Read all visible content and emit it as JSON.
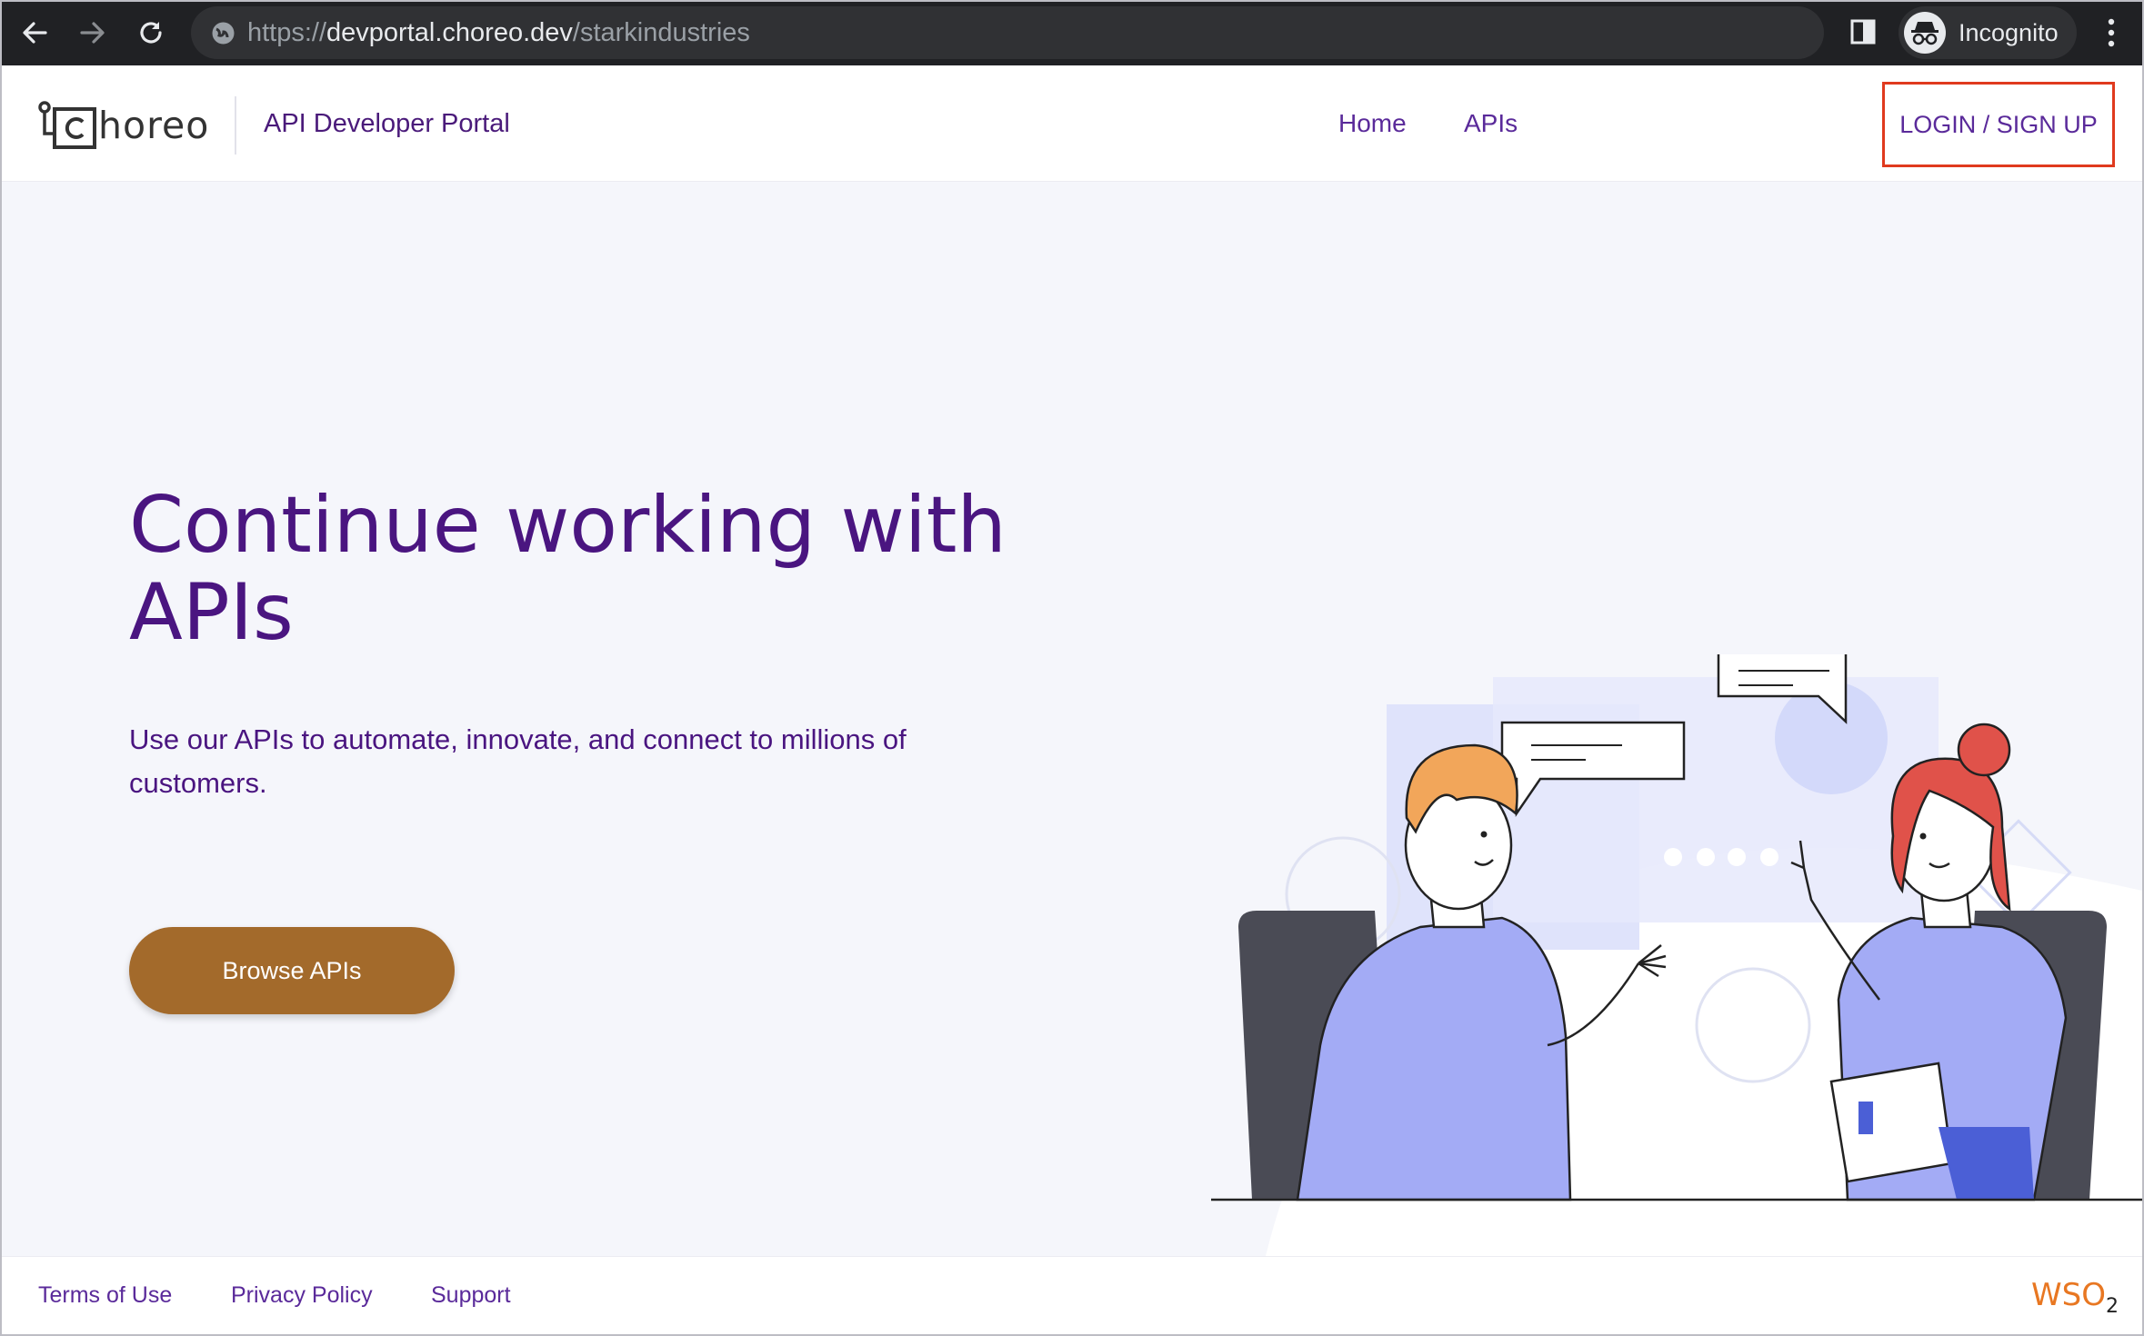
{
  "browser": {
    "url_prefix": "https://",
    "url_host": "devportal.choreo.dev",
    "url_path": "/starkindustries",
    "incognito_label": "Incognito",
    "icons": [
      "back-arrow-icon",
      "forward-arrow-icon",
      "reload-icon",
      "site-info-icon",
      "side-panel-icon",
      "incognito-icon",
      "more-menu-icon"
    ]
  },
  "header": {
    "logo_text": "horeo",
    "portal_title": "API Developer Portal",
    "nav": [
      "Home",
      "APIs"
    ],
    "login_label": "LOGIN / SIGN UP",
    "login_highlight_color": "#e03a1e"
  },
  "hero": {
    "title": "Continue working with APIs",
    "subtitle": "Use our APIs to automate, innovate, and connect to millions of customers.",
    "cta_label": "Browse APIs",
    "cta_color": "#a36a2b",
    "title_color": "#4a1580"
  },
  "footer": {
    "links": [
      "Terms of Use",
      "Privacy Policy",
      "Support"
    ],
    "brand": "WSO",
    "brand_sub": "2"
  }
}
